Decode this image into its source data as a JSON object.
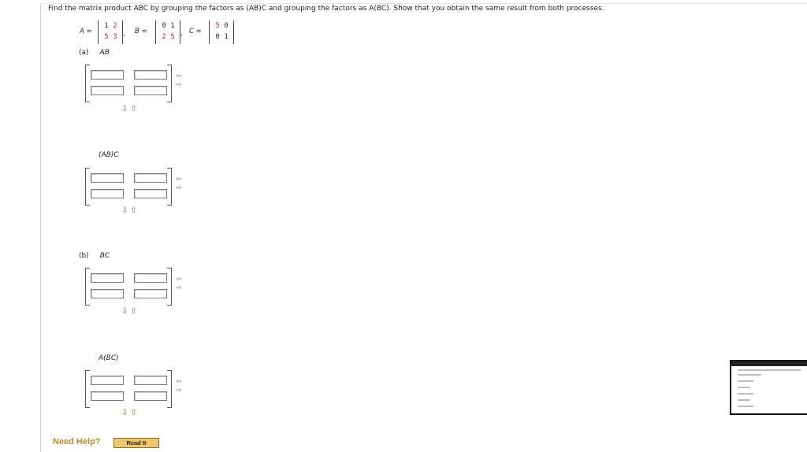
{
  "question": {
    "prompt": "Find the matrix product ABC by grouping the factors as (AB)C and grouping the factors as A(BC). Show that you obtain the same result from both processes."
  },
  "given": {
    "A": {
      "label": "A =",
      "rows": [
        [
          "1",
          "2"
        ],
        [
          "5",
          "3"
        ]
      ]
    },
    "B": {
      "label": "B =",
      "rows": [
        [
          "0",
          "1"
        ],
        [
          "2",
          "5"
        ]
      ]
    },
    "C": {
      "label": "C =",
      "rows": [
        [
          "5",
          "0"
        ],
        [
          "0",
          "1"
        ]
      ]
    },
    "separator": ","
  },
  "parts": {
    "a": {
      "marker": "(a)",
      "label": "AB",
      "second_label": "(AB)C"
    },
    "b": {
      "marker": "(b)",
      "label": "BC",
      "second_label": "A(BC)"
    }
  },
  "controls": {
    "row_add": "⇦",
    "row_remove": "⇨",
    "col_controls": "⇩⇧"
  },
  "answers": {
    "AB": [
      "",
      "",
      "",
      ""
    ],
    "ABC_1": [
      "",
      "",
      "",
      ""
    ],
    "BC": [
      "",
      "",
      "",
      ""
    ],
    "ABC_2": [
      "",
      "",
      "",
      ""
    ]
  },
  "help": {
    "label": "Need Help?",
    "read_it": "Read It"
  }
}
